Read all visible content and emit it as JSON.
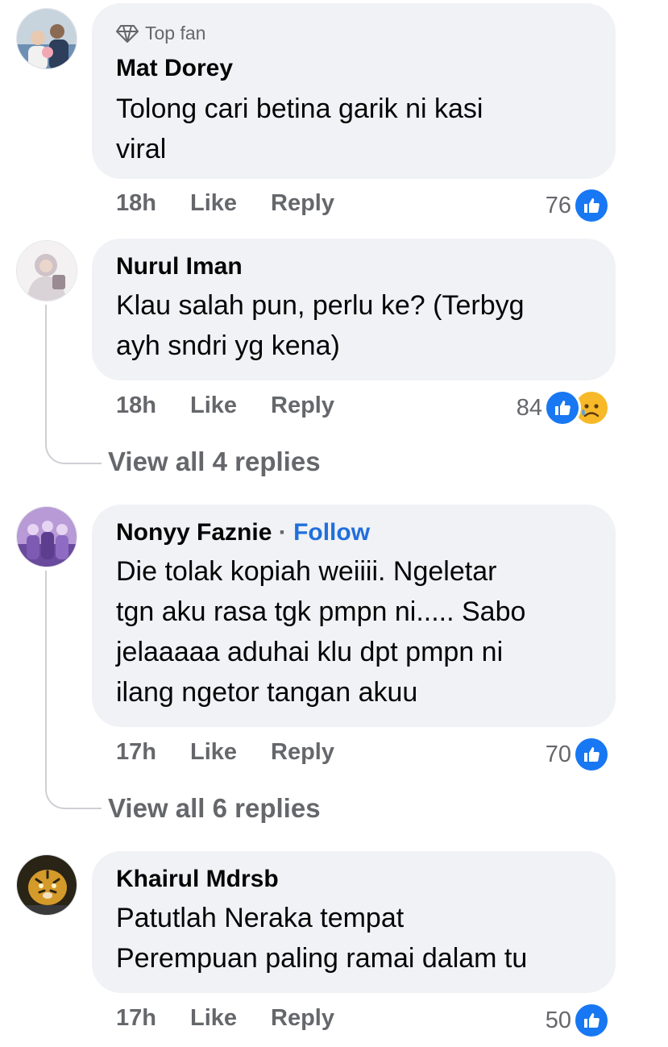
{
  "comments": [
    {
      "badge": "Top fan",
      "badge_icon": "diamond-icon",
      "name": "Mat Dorey",
      "text_lines": [
        "Tolong cari betina garik ni kasi",
        "viral"
      ],
      "time": "18h",
      "like_label": "Like",
      "reply_label": "Reply",
      "reaction_count": "76",
      "reactions": [
        "like-icon"
      ],
      "avatar_colors": [
        "#6d8fb3",
        "#c7d3dd"
      ]
    },
    {
      "name": "Nurul Iman",
      "text_lines": [
        "Klau salah pun, perlu ke? (Terbyg",
        "ayh sndri yg kena)"
      ],
      "time": "18h",
      "like_label": "Like",
      "reply_label": "Reply",
      "reaction_count": "84",
      "reactions": [
        "like-icon",
        "sad-icon"
      ],
      "view_replies": "View all 4 replies",
      "avatar_colors": [
        "#e9e4e6",
        "#b9a9b0"
      ]
    },
    {
      "name": "Nonyy Faznie",
      "separator": "·",
      "follow_label": "Follow",
      "text_lines": [
        "Die tolak kopiah weiiii. Ngeletar",
        "tgn aku rasa tgk pmpn ni..... Sabo",
        "jelaaaaa aduhai klu dpt pmpn ni",
        "ilang ngetor tangan akuu"
      ],
      "time": "17h",
      "like_label": "Like",
      "reply_label": "Reply",
      "reaction_count": "70",
      "reactions": [
        "like-icon"
      ],
      "view_replies": "View all 6 replies",
      "avatar_colors": [
        "#6a4a9c",
        "#b79ad6"
      ]
    },
    {
      "name": "Khairul Mdrsb",
      "text_lines": [
        "Patutlah Neraka tempat",
        "Perempuan paling ramai dalam tu"
      ],
      "time": "17h",
      "like_label": "Like",
      "reply_label": "Reply",
      "reaction_count": "50",
      "reactions": [
        "like-icon"
      ],
      "avatar_colors": [
        "#2a2416",
        "#d49a2a"
      ]
    }
  ],
  "colors": {
    "bubble": "#f0f2f5",
    "secondary_text": "#65676b",
    "like_blue": "#1877f2",
    "follow_blue": "#216fdb",
    "sad_yellow": "#f7b928"
  }
}
